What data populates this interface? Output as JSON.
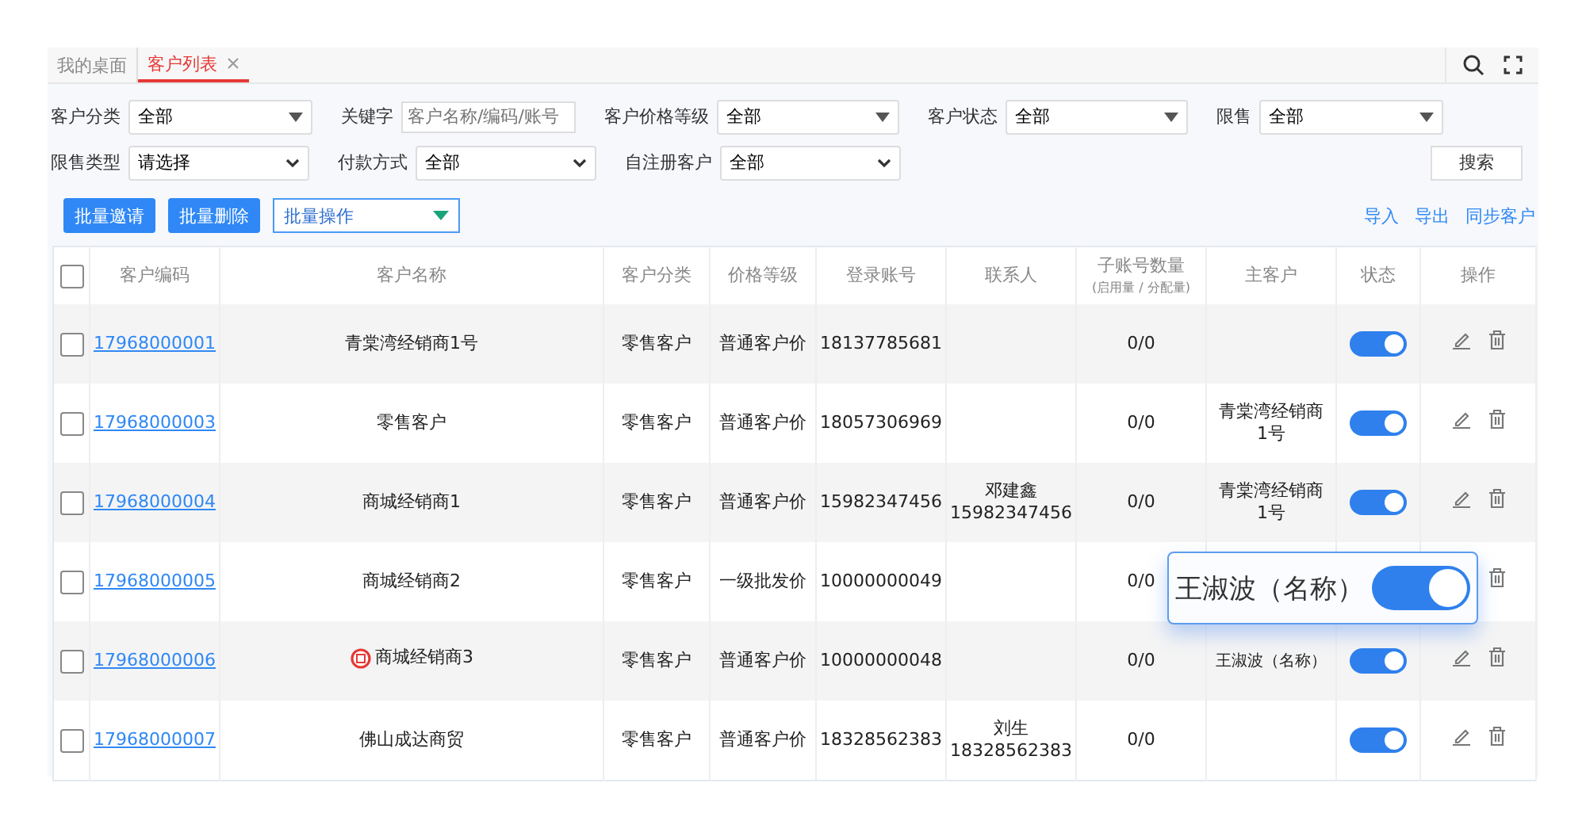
{
  "tabs": [
    {
      "label": "我的桌面",
      "selected": false,
      "closable": false
    },
    {
      "label": "客户列表",
      "selected": true,
      "closable": true
    }
  ],
  "filter_rows": [
    [
      {
        "label": "客户分类",
        "kind": "select",
        "value": "全部"
      },
      {
        "label": "关键字",
        "kind": "input",
        "placeholder": "客户名称/编码/账号"
      },
      {
        "label": "客户价格等级",
        "kind": "select",
        "value": "全部"
      },
      {
        "label": "客户状态",
        "kind": "select",
        "value": "全部"
      },
      {
        "label": "限售",
        "kind": "select",
        "value": "全部"
      }
    ],
    [
      {
        "label": "限售类型",
        "kind": "select",
        "value": "请选择"
      },
      {
        "label": "付款方式",
        "kind": "select",
        "value": "全部"
      },
      {
        "label": "自注册客户",
        "kind": "select",
        "value": "全部"
      }
    ]
  ],
  "search_button": "搜索",
  "toolbar": {
    "buttons": [
      "批量邀请",
      "批量删除"
    ],
    "batch_select": "批量操作",
    "links": [
      "导入",
      "导出",
      "同步客户"
    ]
  },
  "table": {
    "all_selected": false,
    "columns": [
      {
        "label": "客户编码"
      },
      {
        "label": "客户名称"
      },
      {
        "label": "客户分类"
      },
      {
        "label": "价格等级"
      },
      {
        "label": "登录账号"
      },
      {
        "label": "联系人"
      },
      {
        "label": "子账号数量",
        "sublabel": "(启用量 / 分配量)"
      },
      {
        "label": "主客户"
      },
      {
        "label": "状态"
      },
      {
        "label": "操作"
      }
    ],
    "rows": [
      {
        "selected": false,
        "code": "17968000001",
        "name": "青棠湾经销商1号",
        "flagged": false,
        "category": "零售客户",
        "price_level": "普通客户价",
        "account": "18137785681",
        "sub_accounts": "0/0",
        "on": true
      },
      {
        "selected": false,
        "code": "17968000003",
        "name": "零售客户",
        "flagged": false,
        "category": "零售客户",
        "price_level": "普通客户价",
        "account": "18057306969",
        "sub_accounts": "0/0",
        "main_customer": "青棠湾经销商1号",
        "on": true
      },
      {
        "selected": false,
        "code": "17968000004",
        "name": "商城经销商1",
        "flagged": false,
        "category": "零售客户",
        "price_level": "普通客户价",
        "account": "15982347456",
        "contact": "邓建鑫",
        "contact_phone": "15982347456",
        "sub_accounts": "0/0",
        "main_customer": "青棠湾经销商1号",
        "on": true
      },
      {
        "selected": false,
        "code": "17968000005",
        "name": "商城经销商2",
        "flagged": false,
        "category": "零售客户",
        "price_level": "一级批发价",
        "account": "10000000049",
        "sub_accounts": "0/0",
        "editable": false
      },
      {
        "selected": false,
        "code": "17968000006",
        "name": "商城经销商3",
        "flagged": true,
        "category": "零售客户",
        "price_level": "普通客户价",
        "account": "10000000048",
        "sub_accounts": "0/0",
        "main_customer": "王淑波（名称）",
        "on": true
      },
      {
        "selected": false,
        "code": "17968000007",
        "name": "佛山成达商贸",
        "flagged": false,
        "category": "零售客户",
        "price_level": "普通客户价",
        "account": "18328562383",
        "contact": "刘生",
        "contact_phone": "18328562383",
        "sub_accounts": "0/0",
        "on": true
      }
    ]
  },
  "callout": {
    "text": "王淑波（名称）",
    "on": true
  }
}
